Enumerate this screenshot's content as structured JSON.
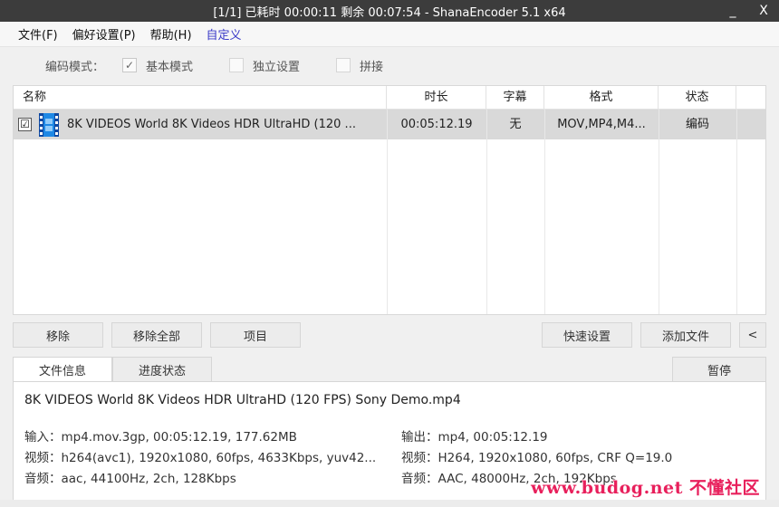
{
  "titlebar": {
    "title": "[1/1] 已耗时 00:00:11  剩余 00:07:54 - ShanaEncoder 5.1 x64",
    "minimize": "_",
    "close": "X"
  },
  "menu": {
    "file": "文件(F)",
    "prefs": "偏好设置(P)",
    "help": "帮助(H)",
    "custom": "自定义"
  },
  "mode": {
    "label": "编码模式：",
    "basic": "基本模式",
    "independent": "独立设置",
    "concat": "拼接"
  },
  "columns": {
    "name": "名称",
    "duration": "时长",
    "subtitle": "字幕",
    "format": "格式",
    "status": "状态"
  },
  "rows": [
    {
      "checked": "☑",
      "name": "8K VIDEOS   World 8K Videos HDR UltraHD  (120 ...",
      "duration": "00:05:12.19",
      "subtitle": "无",
      "format": "MOV,MP4,M4...",
      "status": "编码"
    }
  ],
  "buttons": {
    "remove": "移除",
    "remove_all": "移除全部",
    "item": "项目",
    "quick_settings": "快速设置",
    "add_file": "添加文件",
    "collapse": "<",
    "pause": "暂停"
  },
  "tabs": {
    "file_info": "文件信息",
    "progress": "进度状态"
  },
  "info": {
    "filename": "8K VIDEOS   World 8K Videos HDR UltraHD  (120 FPS)  Sony Demo.mp4",
    "input": "输入：mp4.mov.3gp, 00:05:12.19, 177.62MB",
    "video_in": "视频：h264(avc1), 1920x1080, 60fps, 4633Kbps,  yuv42...",
    "audio_in": "音频：aac, 44100Hz, 2ch, 128Kbps",
    "output": "输出：mp4, 00:05:12.19",
    "video_out": "视频：H264, 1920x1080, 60fps, CRF Q=19.0",
    "audio_out": "音频：AAC, 48000Hz, 2ch, 192Kbps"
  },
  "watermark": "www.budog.net 不懂社区"
}
